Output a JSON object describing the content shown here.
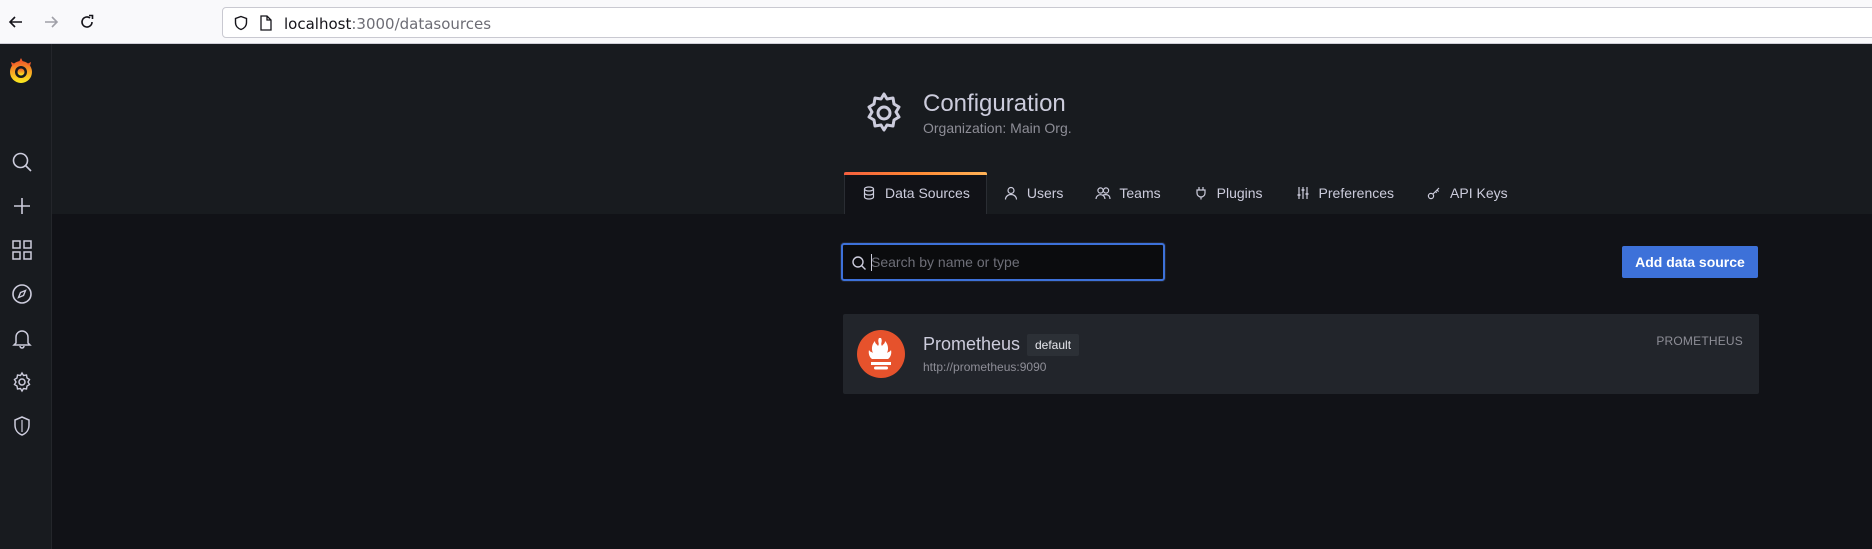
{
  "browser": {
    "url_host": "localhost",
    "url_path": ":3000/datasources",
    "icons": [
      "back-arrow-icon",
      "forward-arrow-icon",
      "reload-icon",
      "shield-icon",
      "page-icon"
    ]
  },
  "sidenav": {
    "items": [
      {
        "name": "grafana-logo"
      },
      {
        "name": "search-icon"
      },
      {
        "name": "plus-icon"
      },
      {
        "name": "dashboards-icon"
      },
      {
        "name": "explore-compass-icon"
      },
      {
        "name": "alerting-bell-icon"
      },
      {
        "name": "configuration-gear-icon"
      },
      {
        "name": "server-admin-shield-icon"
      }
    ]
  },
  "header": {
    "title": "Configuration",
    "subtitle": "Organization: Main Org.",
    "icon": "gear-icon"
  },
  "tabs": [
    {
      "label": "Data Sources",
      "icon": "database-icon",
      "active": true
    },
    {
      "label": "Users",
      "icon": "user-icon",
      "active": false
    },
    {
      "label": "Teams",
      "icon": "users-icon",
      "active": false
    },
    {
      "label": "Plugins",
      "icon": "plug-icon",
      "active": false
    },
    {
      "label": "Preferences",
      "icon": "sliders-icon",
      "active": false
    },
    {
      "label": "API Keys",
      "icon": "key-icon",
      "active": false
    }
  ],
  "search": {
    "placeholder": "Search by name or type",
    "value": ""
  },
  "actions": {
    "add_label": "Add data source"
  },
  "datasources": [
    {
      "name": "Prometheus",
      "badge": "default",
      "url": "http://prometheus:9090",
      "type": "PROMETHEUS"
    }
  ],
  "colors": {
    "accent": "#3d71d9",
    "brand_gradient": [
      "#f55f3e",
      "#ffb357"
    ],
    "prometheus": "#e6522c"
  }
}
